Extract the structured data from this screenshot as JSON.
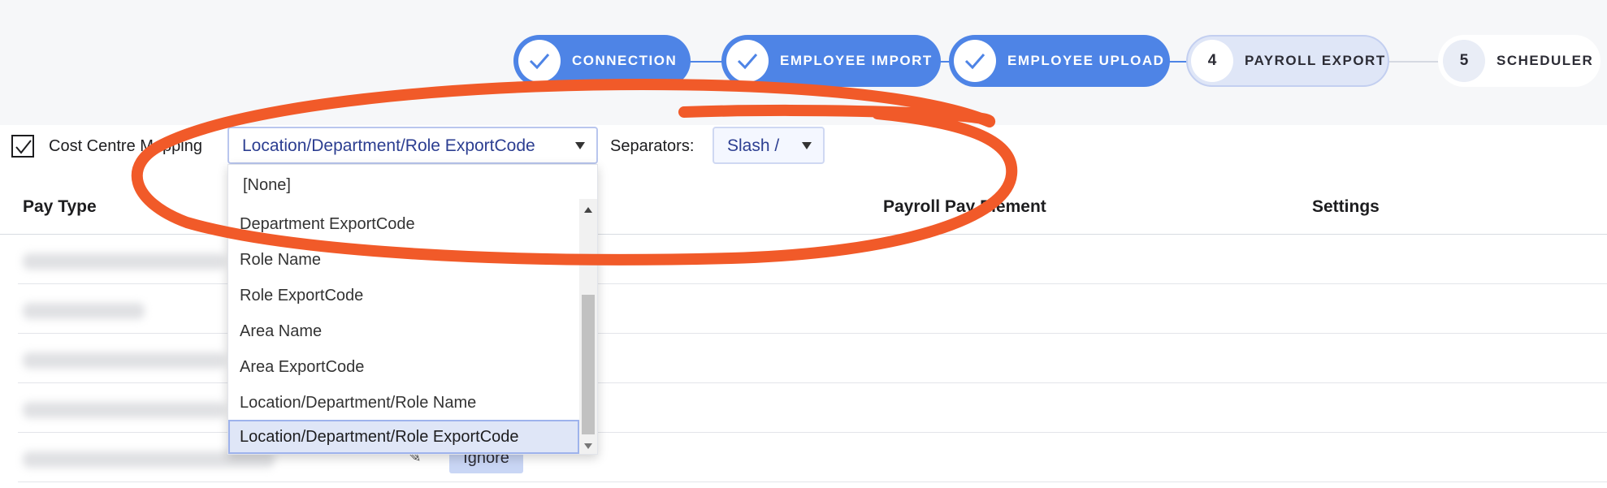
{
  "stepper": {
    "steps": [
      {
        "label": "CONNECTION",
        "state": "done"
      },
      {
        "label": "EMPLOYEE IMPORT",
        "state": "done"
      },
      {
        "label": "EMPLOYEE UPLOAD",
        "state": "done"
      },
      {
        "number": "4",
        "label": "PAYROLL EXPORT",
        "state": "current"
      },
      {
        "number": "5",
        "label": "SCHEDULER",
        "state": "pending"
      }
    ]
  },
  "cost_centre": {
    "checked": true,
    "label": "Cost Centre Mapping",
    "selected_value": "Location/Department/Role ExportCode",
    "separators_label": "Separators:",
    "separator_value": "Slash /"
  },
  "table": {
    "headers": [
      "Pay Type",
      "Payroll Pay Element",
      "Settings"
    ],
    "ignore_label": "Ignore"
  },
  "dropdown": {
    "none_option": "[None]",
    "options": [
      "Department ExportCode",
      "Role Name",
      "Role ExportCode",
      "Area Name",
      "Area ExportCode",
      "Location/Department/Role Name",
      "Location/Department/Role ExportCode"
    ],
    "selected_index": 6
  },
  "colors": {
    "step_done": "#4e84e6",
    "step_current": "#dfe6f7",
    "select_text": "#2c3e91",
    "annotation": "#f15a29"
  }
}
